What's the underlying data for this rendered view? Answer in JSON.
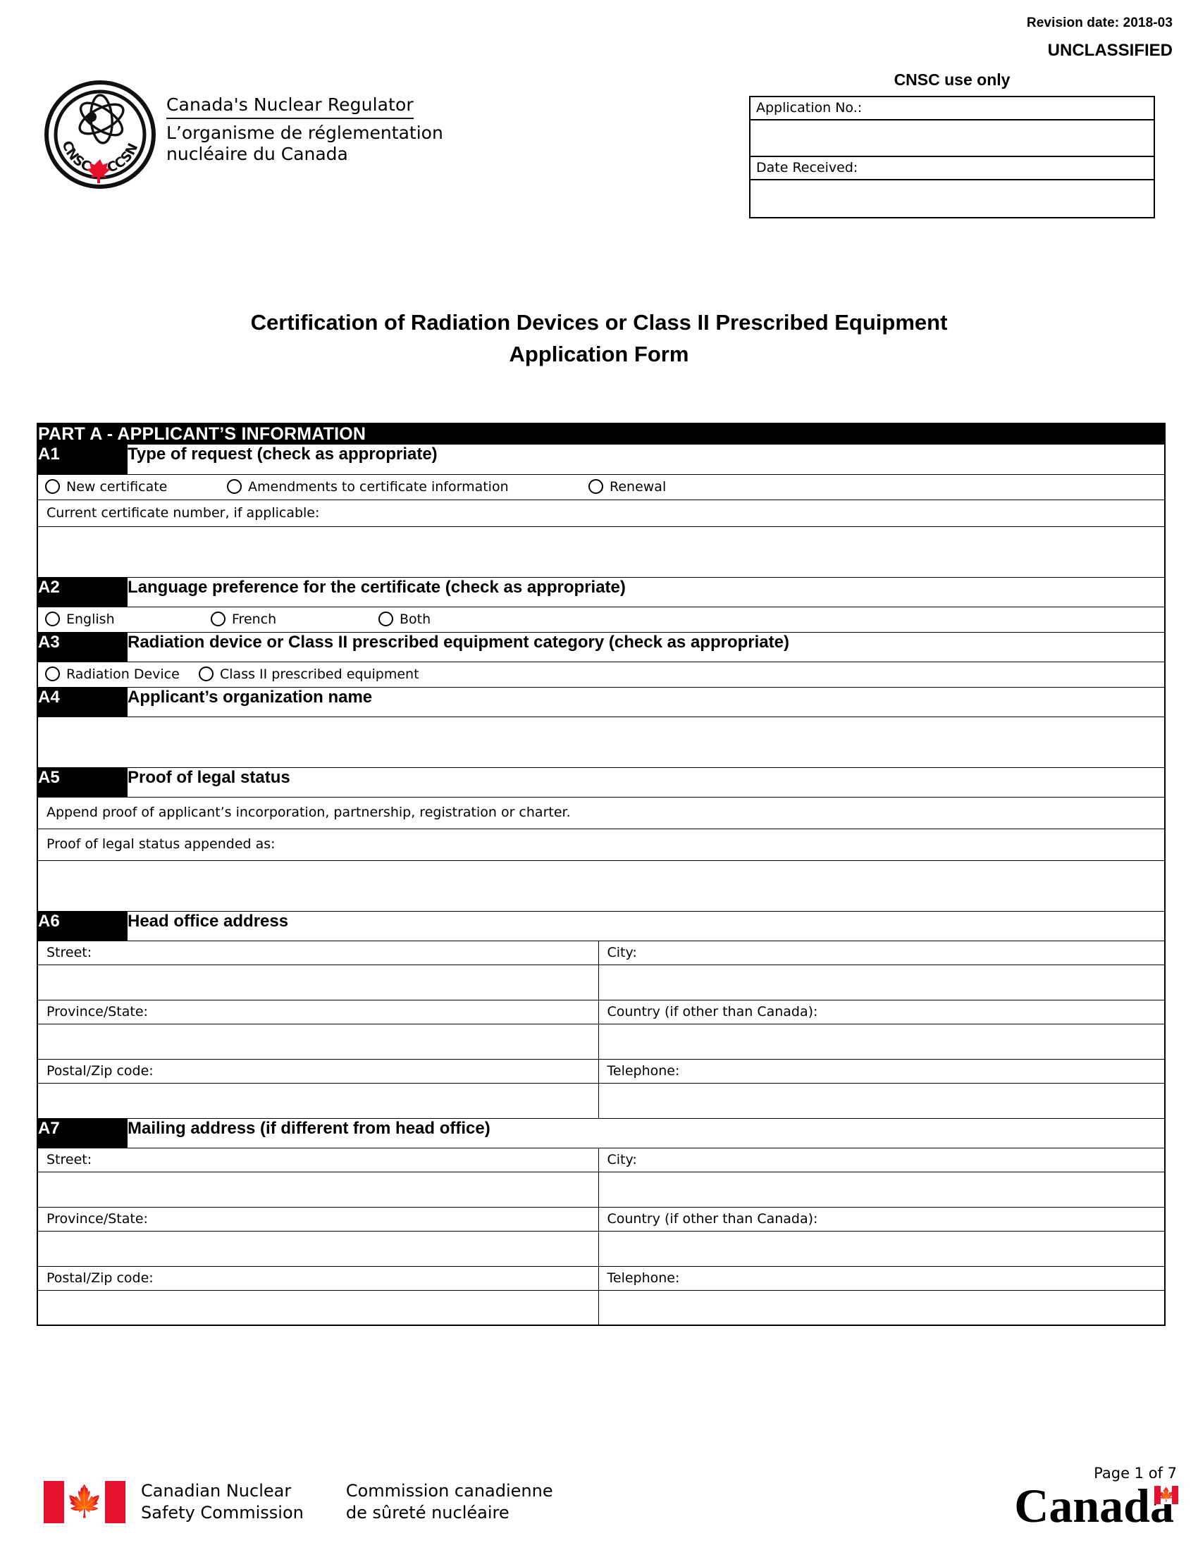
{
  "meta": {
    "revision_date": "Revision date: 2018-03",
    "classification": "UNCLASSIFIED"
  },
  "logo": {
    "mark_name": "cnsc-ccsn-logo",
    "acronym_left": "CNSC",
    "acronym_right": "CCSN",
    "tagline_en": "Canada's Nuclear Regulator",
    "tagline_fr_line1": "L’organisme de réglementation",
    "tagline_fr_line2": "nucléaire du Canada"
  },
  "cnsc_use": {
    "title": "CNSC use only",
    "application_no_label": "Application No.:",
    "date_received_label": "Date Received:"
  },
  "title": {
    "line1": "Certification of Radiation Devices or Class II Prescribed Equipment",
    "line2": "Application Form"
  },
  "part_a": {
    "header": "PART A - APPLICANT’S INFORMATION",
    "sections": {
      "a1": {
        "code": "A1",
        "title": "Type of request (check as appropriate)",
        "options": [
          "New certificate",
          "Amendments to certificate information",
          "Renewal"
        ],
        "sub_label": "Current certificate number, if applicable:"
      },
      "a2": {
        "code": "A2",
        "title": "Language preference for the certificate (check as appropriate)",
        "options": [
          "English",
          "French",
          "Both"
        ]
      },
      "a3": {
        "code": "A3",
        "title": "Radiation device or Class II prescribed equipment category (check as appropriate)",
        "options": [
          "Radiation Device",
          "Class II prescribed equipment"
        ]
      },
      "a4": {
        "code": "A4",
        "title": "Applicant’s organization name"
      },
      "a5": {
        "code": "A5",
        "title": "Proof of legal status",
        "note": "Append proof of applicant’s incorporation, partnership, registration or charter.",
        "sub_label": "Proof of legal status appended as:"
      },
      "a6": {
        "code": "A6",
        "title": "Head office address",
        "street_label": "Street:",
        "city_label": "City:",
        "province_label": "Province/State:",
        "country_label": "Country (if other than Canada):",
        "postal_label": "Postal/Zip code:",
        "telephone_label": "Telephone:"
      },
      "a7": {
        "code": "A7",
        "title": "Mailing address (if different from head office)",
        "street_label": "Street:",
        "city_label": "City:",
        "province_label": "Province/State:",
        "country_label": "Country (if other than Canada):",
        "postal_label": "Postal/Zip code:",
        "telephone_label": "Telephone:"
      }
    }
  },
  "footer": {
    "org_en_line1": "Canadian Nuclear",
    "org_en_line2": "Safety Commission",
    "org_fr_line1": "Commission canadienne",
    "org_fr_line2": "de sûreté nucléaire",
    "page_number": "Page 1 of 7",
    "wordmark": "Canada"
  },
  "colors": {
    "flag_red": "#e8112d",
    "header_black": "#000000"
  }
}
